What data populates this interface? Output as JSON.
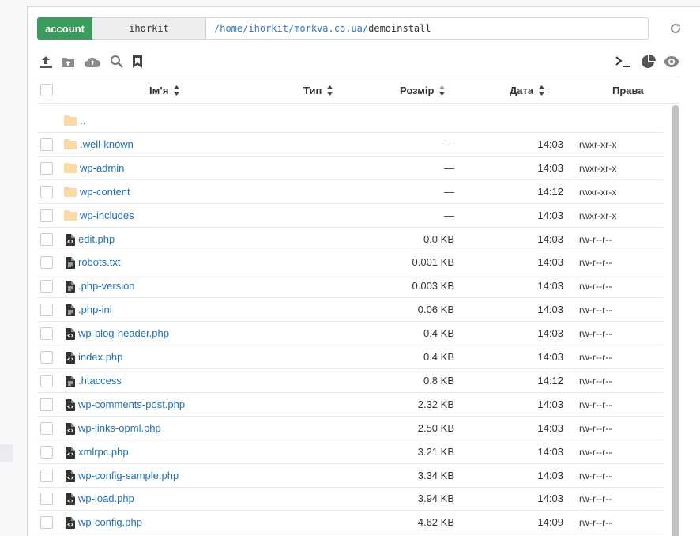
{
  "pathbar": {
    "account_label": "account",
    "user": "ihorkit",
    "path_root": "/",
    "path_segments": [
      "home",
      "ihorkit",
      "morkva.co.ua"
    ],
    "path_current": "demoinstall"
  },
  "toolbar": {
    "left_icons": [
      "upload-icon",
      "new-folder-icon",
      "cloud-upload-icon",
      "search-icon",
      "bookmark-icon"
    ],
    "right_icons": [
      "terminal-icon",
      "disk-usage-pie-icon",
      "eye-icon"
    ]
  },
  "table": {
    "columns": {
      "name": "Ім’я",
      "type": "Тип",
      "size": "Розмір",
      "date": "Дата",
      "perms": "Права"
    },
    "rows": [
      {
        "kind": "parent",
        "name": "..",
        "size": "",
        "date": "",
        "perms": ""
      },
      {
        "kind": "dir",
        "name": ".well-known",
        "size": "—",
        "date": "14:03",
        "perms": "rwxr-xr-x"
      },
      {
        "kind": "dir",
        "name": "wp-admin",
        "size": "—",
        "date": "14:03",
        "perms": "rwxr-xr-x"
      },
      {
        "kind": "dir",
        "name": "wp-content",
        "size": "—",
        "date": "14:12",
        "perms": "rwxr-xr-x"
      },
      {
        "kind": "dir",
        "name": "wp-includes",
        "size": "—",
        "date": "14:03",
        "perms": "rwxr-xr-x"
      },
      {
        "kind": "code",
        "name": "edit.php",
        "size": "0.0 KB",
        "date": "14:03",
        "perms": "rw-r--r--"
      },
      {
        "kind": "text",
        "name": "robots.txt",
        "size": "0.001 KB",
        "date": "14:03",
        "perms": "rw-r--r--"
      },
      {
        "kind": "text",
        "name": ".php-version",
        "size": "0.003 KB",
        "date": "14:03",
        "perms": "rw-r--r--"
      },
      {
        "kind": "text",
        "name": ".php-ini",
        "size": "0.06 KB",
        "date": "14:03",
        "perms": "rw-r--r--"
      },
      {
        "kind": "code",
        "name": "wp-blog-header.php",
        "size": "0.4 KB",
        "date": "14:03",
        "perms": "rw-r--r--"
      },
      {
        "kind": "code",
        "name": "index.php",
        "size": "0.4 KB",
        "date": "14:03",
        "perms": "rw-r--r--"
      },
      {
        "kind": "text",
        "name": ".htaccess",
        "size": "0.8 KB",
        "date": "14:12",
        "perms": "rw-r--r--"
      },
      {
        "kind": "code",
        "name": "wp-comments-post.php",
        "size": "2.32 KB",
        "date": "14:03",
        "perms": "rw-r--r--"
      },
      {
        "kind": "code",
        "name": "wp-links-opml.php",
        "size": "2.50 KB",
        "date": "14:03",
        "perms": "rw-r--r--"
      },
      {
        "kind": "code",
        "name": "xmlrpc.php",
        "size": "3.21 KB",
        "date": "14:03",
        "perms": "rw-r--r--"
      },
      {
        "kind": "code",
        "name": "wp-config-sample.php",
        "size": "3.34 KB",
        "date": "14:03",
        "perms": "rw-r--r--"
      },
      {
        "kind": "code",
        "name": "wp-load.php",
        "size": "3.94 KB",
        "date": "14:03",
        "perms": "rw-r--r--"
      },
      {
        "kind": "code",
        "name": "wp-config.php",
        "size": "4.62 KB",
        "date": "14:09",
        "perms": "rw-r--r--"
      }
    ]
  },
  "colors": {
    "accent_green": "#3a9d5d",
    "link_blue": "#1f6fb5",
    "folder_yellow": "#f9d9a4"
  }
}
